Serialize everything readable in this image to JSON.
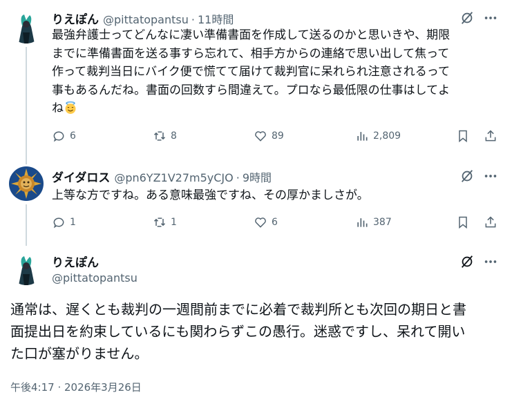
{
  "tweets": [
    {
      "name": "りえぽん",
      "handle": "@pittatopantsu",
      "time": "11時間",
      "text_lines": [
        "最強弁護士ってどんなに凄い準備書面を作成して送るのかと思いきや、期限",
        "までに準備書面を送る事すら忘れて、相手方からの連絡で思い出して焦って",
        "作って裁判当日にバイク便で慌てて届けて裁判官に呆れられ注意されるって",
        "事もあるんだね。書面の回数すら間違えて。プロなら最低限の仕事はしてよ",
        "ね"
      ],
      "emoji": "smiling-face-with-halo",
      "replies": "6",
      "retweets": "8",
      "likes": "89",
      "views": "2,809"
    },
    {
      "name": "ダイダロス",
      "handle": "@pn6YZ1V27m5yCJO",
      "time": "9時間",
      "text_lines": [
        "上等な方ですね。ある意味最強ですね、その厚かましさが。"
      ],
      "replies": "1",
      "retweets": "1",
      "likes": "6",
      "views": "387"
    }
  ],
  "main_tweet": {
    "name": "りえぽん",
    "handle": "@pittatopantsu",
    "text_lines": [
      "通常は、遅くとも裁判の一週間前までに必着で裁判所とも次回の期日と書",
      "面提出日を約束しているにも関わらずこの愚行。迷惑ですし、呆れて開い",
      "た口が塞がりません。"
    ],
    "timestamp": "午後4:17 · 2026年3月26日"
  },
  "icons": {
    "grok": "grok-icon",
    "more": "more-icon",
    "reply": "reply-icon",
    "retweet": "retweet-icon",
    "like": "heart-icon",
    "views": "views-icon",
    "bookmark": "bookmark-icon",
    "share": "share-icon"
  },
  "colors": {
    "text": "#0f1419",
    "secondary": "#536471",
    "thread_line": "#cfd9de"
  }
}
